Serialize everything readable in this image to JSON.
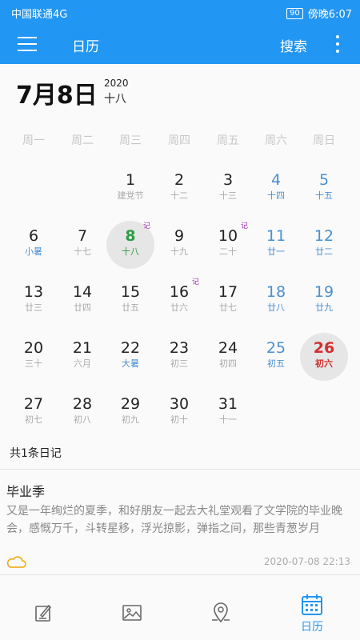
{
  "status_bar": {
    "carrier": "中国联通4G",
    "battery": "90",
    "time": "傍晚6:07"
  },
  "app_bar": {
    "title": "日历",
    "search_label": "搜索"
  },
  "date_header": {
    "date": "7月8日",
    "year": "2020",
    "lunar": "十八"
  },
  "weekdays": [
    "周一",
    "周二",
    "周三",
    "周四",
    "周五",
    "周六",
    "周日"
  ],
  "calendar": {
    "weeks": [
      [
        {
          "day": "",
          "lunar": ""
        },
        {
          "day": "",
          "lunar": ""
        },
        {
          "day": "1",
          "lunar": "建党节"
        },
        {
          "day": "2",
          "lunar": "十二"
        },
        {
          "day": "3",
          "lunar": "十三"
        },
        {
          "day": "4",
          "lunar": "十四"
        },
        {
          "day": "5",
          "lunar": "十五"
        }
      ],
      [
        {
          "day": "6",
          "lunar": "小暑",
          "term": true
        },
        {
          "day": "7",
          "lunar": "十七"
        },
        {
          "day": "8",
          "lunar": "十八",
          "selected": true,
          "mark": "记"
        },
        {
          "day": "9",
          "lunar": "十九"
        },
        {
          "day": "10",
          "lunar": "二十",
          "mark": "记"
        },
        {
          "day": "11",
          "lunar": "廿一"
        },
        {
          "day": "12",
          "lunar": "廿二"
        }
      ],
      [
        {
          "day": "13",
          "lunar": "廿三"
        },
        {
          "day": "14",
          "lunar": "廿四"
        },
        {
          "day": "15",
          "lunar": "廿五"
        },
        {
          "day": "16",
          "lunar": "廿六",
          "mark": "记"
        },
        {
          "day": "17",
          "lunar": "廿七"
        },
        {
          "day": "18",
          "lunar": "廿八"
        },
        {
          "day": "19",
          "lunar": "廿九"
        }
      ],
      [
        {
          "day": "20",
          "lunar": "三十"
        },
        {
          "day": "21",
          "lunar": "六月"
        },
        {
          "day": "22",
          "lunar": "大暑",
          "term": true
        },
        {
          "day": "23",
          "lunar": "初三"
        },
        {
          "day": "24",
          "lunar": "初四"
        },
        {
          "day": "25",
          "lunar": "初五"
        },
        {
          "day": "26",
          "lunar": "初六",
          "today": true
        }
      ],
      [
        {
          "day": "27",
          "lunar": "初七"
        },
        {
          "day": "28",
          "lunar": "初八"
        },
        {
          "day": "29",
          "lunar": "初九"
        },
        {
          "day": "30",
          "lunar": "初十"
        },
        {
          "day": "31",
          "lunar": "十一"
        },
        {
          "day": "",
          "lunar": ""
        },
        {
          "day": "",
          "lunar": ""
        }
      ]
    ]
  },
  "diary": {
    "count_label": "共1条日记",
    "entries": [
      {
        "title": "毕业季",
        "body": "又是一年绚烂的夏季，和好朋友一起去大礼堂观看了文学院的毕业晚会，感慨万千，斗转星移，浮光掠影，弹指之间，那些青葱岁月",
        "weather_icon": "cloud-icon",
        "timestamp": "2020-07-08 22:13"
      }
    ]
  },
  "bottom_nav": {
    "items": [
      {
        "icon": "edit-note-icon",
        "label": ""
      },
      {
        "icon": "image-icon",
        "label": ""
      },
      {
        "icon": "map-pin-icon",
        "label": ""
      },
      {
        "icon": "calendar-icon",
        "label": "日历",
        "active": true
      }
    ]
  },
  "colors": {
    "primary": "#2196f3",
    "weekend": "#4a90d0",
    "selected": "#2e9d47",
    "today": "#d32f2f",
    "mark": "#9c27b0"
  }
}
